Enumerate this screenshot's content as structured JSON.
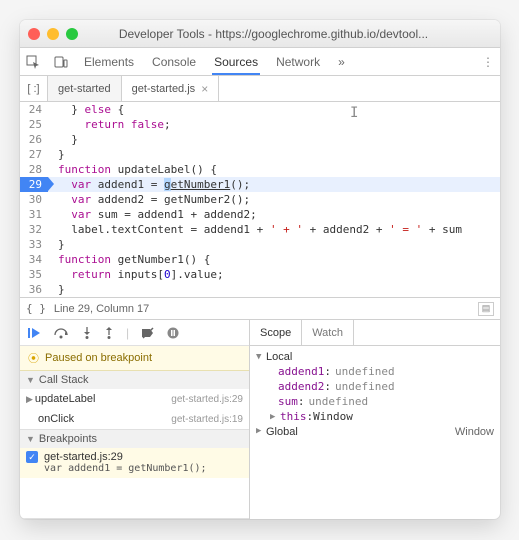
{
  "window": {
    "title": "Developer Tools - https://googlechrome.github.io/devtool..."
  },
  "tabs": {
    "elements": "Elements",
    "console": "Console",
    "sources": "Sources",
    "network": "Network"
  },
  "fileTabs": {
    "file1": "get-started",
    "file2": "get-started.js"
  },
  "code": {
    "lines": [
      {
        "n": 24,
        "indent": 1,
        "tokens": [
          {
            "t": "} "
          },
          {
            "t": "else",
            "c": "kw"
          },
          {
            "t": " {"
          }
        ]
      },
      {
        "n": 25,
        "indent": 2,
        "tokens": [
          {
            "t": "return ",
            "c": "kw"
          },
          {
            "t": "false",
            "c": "kw"
          },
          {
            "t": ";"
          }
        ]
      },
      {
        "n": 26,
        "indent": 1,
        "tokens": [
          {
            "t": "}"
          }
        ]
      },
      {
        "n": 27,
        "indent": 0,
        "tokens": [
          {
            "t": "}"
          }
        ]
      },
      {
        "n": 28,
        "indent": 0,
        "tokens": [
          {
            "t": "function ",
            "c": "kw"
          },
          {
            "t": "updateLabel"
          },
          {
            "t": "() {"
          }
        ]
      },
      {
        "n": 29,
        "indent": 1,
        "hl": true,
        "bp": true,
        "tokens": [
          {
            "t": "var ",
            "c": "kw"
          },
          {
            "t": "addend1 = "
          },
          {
            "t": "g",
            "sel": true
          },
          {
            "t": "etNumber1",
            "u": true
          },
          {
            "t": "();"
          }
        ]
      },
      {
        "n": 30,
        "indent": 1,
        "tokens": [
          {
            "t": "var ",
            "c": "kw"
          },
          {
            "t": "addend2 = getNumber2();"
          }
        ]
      },
      {
        "n": 31,
        "indent": 1,
        "tokens": [
          {
            "t": "var ",
            "c": "kw"
          },
          {
            "t": "sum = addend1 + addend2;"
          }
        ]
      },
      {
        "n": 32,
        "indent": 1,
        "tokens": [
          {
            "t": "label.textContent = addend1 + "
          },
          {
            "t": "' + '",
            "c": "str"
          },
          {
            "t": " + addend2 + "
          },
          {
            "t": "' = '",
            "c": "str"
          },
          {
            "t": " + sum"
          }
        ]
      },
      {
        "n": 33,
        "indent": 0,
        "tokens": [
          {
            "t": "}"
          }
        ]
      },
      {
        "n": 34,
        "indent": 0,
        "tokens": [
          {
            "t": "function ",
            "c": "kw"
          },
          {
            "t": "getNumber1"
          },
          {
            "t": "() {"
          }
        ]
      },
      {
        "n": 35,
        "indent": 1,
        "tokens": [
          {
            "t": "return ",
            "c": "kw"
          },
          {
            "t": "inputs["
          },
          {
            "t": "0",
            "c": "num"
          },
          {
            "t": "].value;"
          }
        ]
      },
      {
        "n": 36,
        "indent": 0,
        "tokens": [
          {
            "t": "}"
          }
        ]
      }
    ]
  },
  "status": {
    "pos": "Line 29, Column 17"
  },
  "debugger": {
    "paused": "Paused on breakpoint",
    "callstack_title": "Call Stack",
    "callstack": [
      {
        "name": "updateLabel",
        "loc": "get-started.js:29"
      },
      {
        "name": "onClick",
        "loc": "get-started.js:19"
      }
    ],
    "breakpoints_title": "Breakpoints",
    "breakpoint": {
      "label": "get-started.js:29",
      "code": "var addend1 = getNumber1();"
    },
    "scope_tab": "Scope",
    "watch_tab": "Watch",
    "scope": {
      "local_label": "Local",
      "vars": [
        {
          "name": "addend1",
          "val": "undefined"
        },
        {
          "name": "addend2",
          "val": "undefined"
        },
        {
          "name": "sum",
          "val": "undefined"
        }
      ],
      "this_label": "this",
      "this_val": "Window",
      "global_label": "Global",
      "global_val": "Window"
    }
  }
}
